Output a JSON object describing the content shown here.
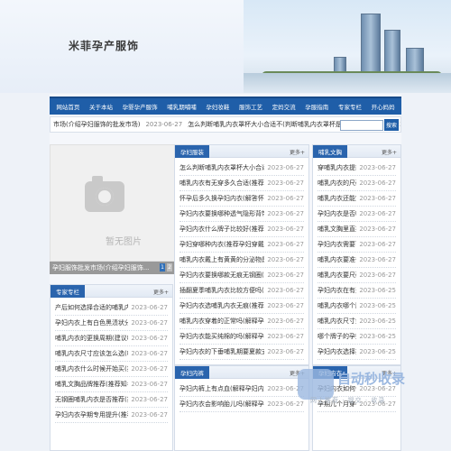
{
  "header": {
    "site_title": "米菲孕产服饰"
  },
  "nav": [
    "网站首页",
    "关于本站",
    "孕婴孕产服饰",
    "哺乳期哺哺",
    "孕妇妆鞋",
    "服饰工艺",
    "定妈交流",
    "孕服指南",
    "专家专栏",
    "开心妈妈"
  ],
  "ticker": [
    {
      "text": "市场(介绍孕妇服饰的批发市场)",
      "date": "2023-06-27"
    },
    {
      "text": "怎么判断哺乳内衣罩杯大小合适不(判断哺乳内衣罩杯是否合适的方法)",
      "date": "2023-06-27"
    }
  ],
  "search": {
    "button": "搜索"
  },
  "photo": {
    "placeholder": "暂无图片",
    "caption": "孕妇服饰批发市场(介绍孕妇服饰...",
    "pages": [
      "1",
      "2",
      "3",
      "4",
      "5"
    ]
  },
  "expert": {
    "title": "专家专栏",
    "more": "更多+",
    "items": [
      {
        "text": "产后如何选择合适的哺乳内衣(推荐产",
        "date": "2023-06-27"
      },
      {
        "text": "孕妇内衣上有白色黑渍状分泌物的原因",
        "date": "2023-06-27"
      },
      {
        "text": "哺乳内衣的更换周期(建议哺乳内衣的",
        "date": "2023-06-27"
      },
      {
        "text": "哺乳内衣尺寸应该怎么选(哺乳期选择哺",
        "date": "2023-06-27"
      },
      {
        "text": "哺乳内衣什么时候开始买(推荐孕期哺乳",
        "date": "2023-06-27"
      },
      {
        "text": "哺乳文胸品牌推荐(推荐知名的哺乳文",
        "date": "2023-06-27"
      },
      {
        "text": "无钢圈哺乳内衣是否推荐(推荐无钢圈",
        "date": "2023-06-27"
      },
      {
        "text": "孕妇内衣孕期专用提升(推荐专为孕期",
        "date": "2023-06-27"
      }
    ]
  },
  "maternity": {
    "title": "孕妇服装",
    "more": "更多+",
    "items": [
      {
        "text": "怎么判断哺乳内衣罩杯大小合适不(判断哺乳",
        "date": "2023-06-27"
      },
      {
        "text": "哺乳内衣有无穿多久合适(推荐哺乳内衣的适",
        "date": "2023-06-27"
      },
      {
        "text": "怀孕后多久换孕妇内衣(解答怀孕后多久需要",
        "date": "2023-06-27"
      },
      {
        "text": "孕妇内衣要换哪种透气隐形背带(推荐哺乳期",
        "date": "2023-06-27"
      },
      {
        "text": "孕妇内衣什么牌子比较好(推荐孕妇内衣的好",
        "date": "2023-06-27"
      },
      {
        "text": "孕妇穿哪种内衣(推荐孕妇穿戴的款式)",
        "date": "2023-06-27"
      },
      {
        "text": "哺乳内衣戴上有黄黄的分泌物是怎么回事，有",
        "date": "2023-06-27"
      },
      {
        "text": "孕妇内衣要换哪款无痕无钢圈(推荐夏季",
        "date": "2023-06-27"
      },
      {
        "text": "插翻夏季哺乳内衣比较方便吗(介绍插翻哺乳",
        "date": "2023-06-27"
      },
      {
        "text": "孕妇内衣选哺乳内衣无痕(推荐无痕设计的孕",
        "date": "2023-06-27"
      },
      {
        "text": "哺乳内衣穿着的正常吗(解释孕妇内衣肩带",
        "date": "2023-06-27"
      },
      {
        "text": "孕妇内衣能买纯棉的吗(解释孕妇内衣的面料",
        "date": "2023-06-27"
      },
      {
        "text": "孕妇内衣的下垂哺乳期要夏款式(推荐夏季",
        "date": "2023-06-27"
      }
    ]
  },
  "bras": {
    "title": "哺乳文胸",
    "more": "更多+",
    "items": [
      {
        "text": "穿哺乳内衣提前变形吗",
        "date": "2023-06-27"
      },
      {
        "text": "哺乳内衣的尺码打包了如何",
        "date": "2023-06-27"
      },
      {
        "text": "哺乳内衣还能穿几年之前",
        "date": "2023-06-27"
      },
      {
        "text": "孕妇内衣是否哺乳期专用",
        "date": "2023-06-27"
      },
      {
        "text": "哺乳文胸里直播间的多样",
        "date": "2023-06-27"
      },
      {
        "text": "孕妇内衣需要可调(推荐",
        "date": "2023-06-27"
      },
      {
        "text": "哺乳内衣要准备几件合",
        "date": "2023-06-27"
      },
      {
        "text": "哺乳内衣要尺码长长不",
        "date": "2023-06-27"
      },
      {
        "text": "孕妇内衣在有无长短(推荐",
        "date": "2023-06-25"
      },
      {
        "text": "哺乳内衣哪个牌子的(推",
        "date": "2023-06-25"
      },
      {
        "text": "哺乳内衣尺寸如何做尺寸",
        "date": "2023-06-25"
      },
      {
        "text": "哪个牌子的孕妇服饰好",
        "date": "2023-06-25"
      },
      {
        "text": "孕妇内衣选择推荐一款",
        "date": "2023-06-25"
      }
    ]
  },
  "pregnant": {
    "title": "孕妇内裤",
    "more": "更多+",
    "items": [
      {
        "text": "孕妇内裤上有点血(解释孕妇内裤出现少量血",
        "date": "2023-06-27"
      },
      {
        "text": "孕妇内衣会影响胎儿吗(解释孕妇内衣对胎",
        "date": "2023-06-27"
      }
    ]
  },
  "lingerie": {
    "title": "孕妇内衣",
    "more": "更多+",
    "items": [
      {
        "text": "孕妇内衣如何保养",
        "date": "2023-06-27"
      },
      {
        "text": "孕期几个月穿孕妇内衣",
        "date": "2023-06-27"
      }
    ]
  },
  "watermark": {
    "title": "自动秒收录",
    "subtitle": "网上推荐 · 提交 · 收录"
  }
}
